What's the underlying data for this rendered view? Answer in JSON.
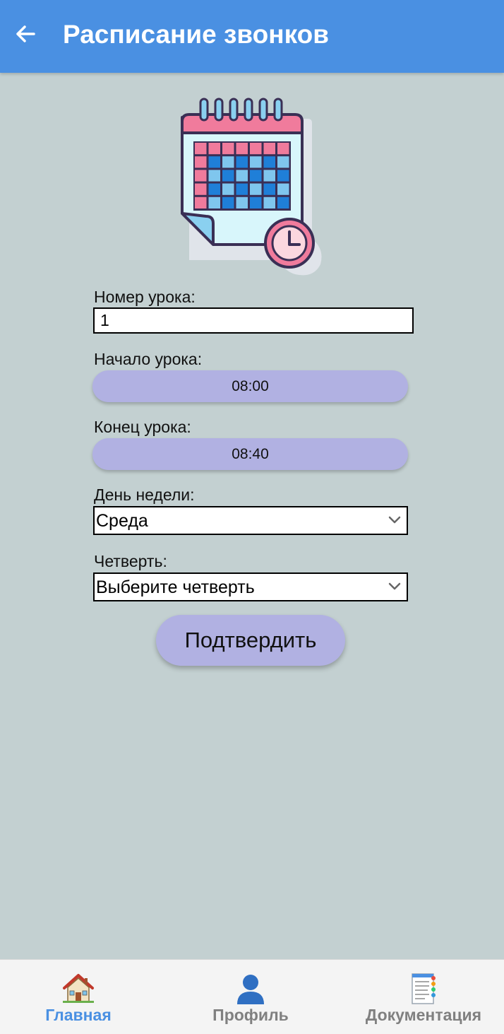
{
  "appbar": {
    "title": "Расписание звонков",
    "back_icon": "arrow-left-icon"
  },
  "illustration": {
    "icon": "calendar-clock-icon"
  },
  "form": {
    "lesson_number": {
      "label": "Номер урока:",
      "value": "1"
    },
    "start": {
      "label": "Начало урока:",
      "value": "08:00"
    },
    "end": {
      "label": "Конец урока:",
      "value": "08:40"
    },
    "weekday": {
      "label": "День недели:",
      "selected": "Среда"
    },
    "quarter": {
      "label": "Четверть:",
      "selected": "Выберите четверть"
    },
    "confirm_label": "Подтвердить"
  },
  "bottom_nav": {
    "items": [
      {
        "label": "Главная",
        "icon": "house-icon",
        "active": true
      },
      {
        "label": "Профиль",
        "icon": "user-icon",
        "active": false
      },
      {
        "label": "Документация",
        "icon": "document-icon",
        "active": false
      }
    ]
  },
  "colors": {
    "appbar": "#4a90e2",
    "background": "#c3d0d1",
    "pill": "#b1b1e2",
    "active_nav": "#4a90e2",
    "inactive_nav": "#808080"
  }
}
